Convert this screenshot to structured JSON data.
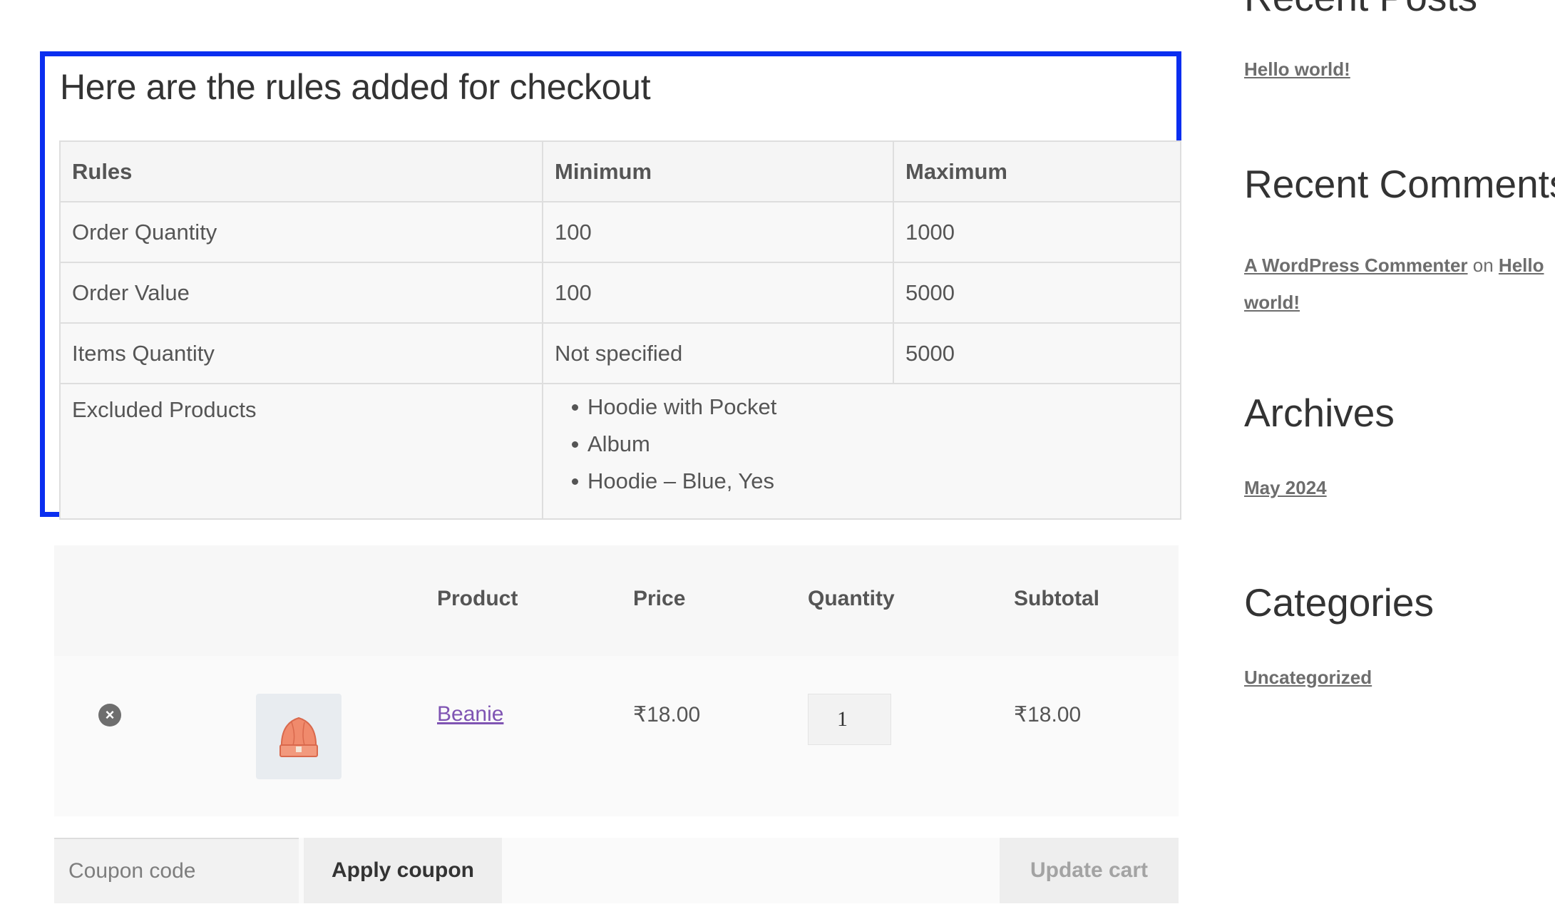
{
  "rules": {
    "title": "Here are the rules added for checkout",
    "headers": [
      "Rules",
      "Minimum",
      "Maximum"
    ],
    "rows": [
      [
        "Order Quantity",
        "100",
        "1000"
      ],
      [
        "Order Value",
        "100",
        "5000"
      ],
      [
        "Items Quantity",
        "Not specified",
        "5000"
      ]
    ],
    "excluded_label": "Excluded Products",
    "excluded_items": [
      "Hoodie with Pocket",
      "Album",
      "Hoodie – Blue, Yes"
    ],
    "highlight_color": "#0a2ef0"
  },
  "cart": {
    "headers": {
      "product": "Product",
      "price": "Price",
      "quantity": "Quantity",
      "subtotal": "Subtotal"
    },
    "items": [
      {
        "remove_icon": "×",
        "product": "Beanie",
        "price": "₹18.00",
        "quantity": "1",
        "subtotal": "₹18.00"
      }
    ],
    "coupon_placeholder": "Coupon code",
    "apply_label": "Apply coupon",
    "update_label": "Update cart"
  },
  "sidebar": {
    "recent_posts_title": "Recent Posts",
    "recent_post": "Hello world!",
    "recent_comments_title": "Recent Comments",
    "comment_author": "A WordPress Commenter",
    "comment_on": "on",
    "comment_post": "Hello world!",
    "archives_title": "Archives",
    "archive_item": "May 2024",
    "categories_title": "Categories",
    "category_item": "Uncategorized"
  }
}
